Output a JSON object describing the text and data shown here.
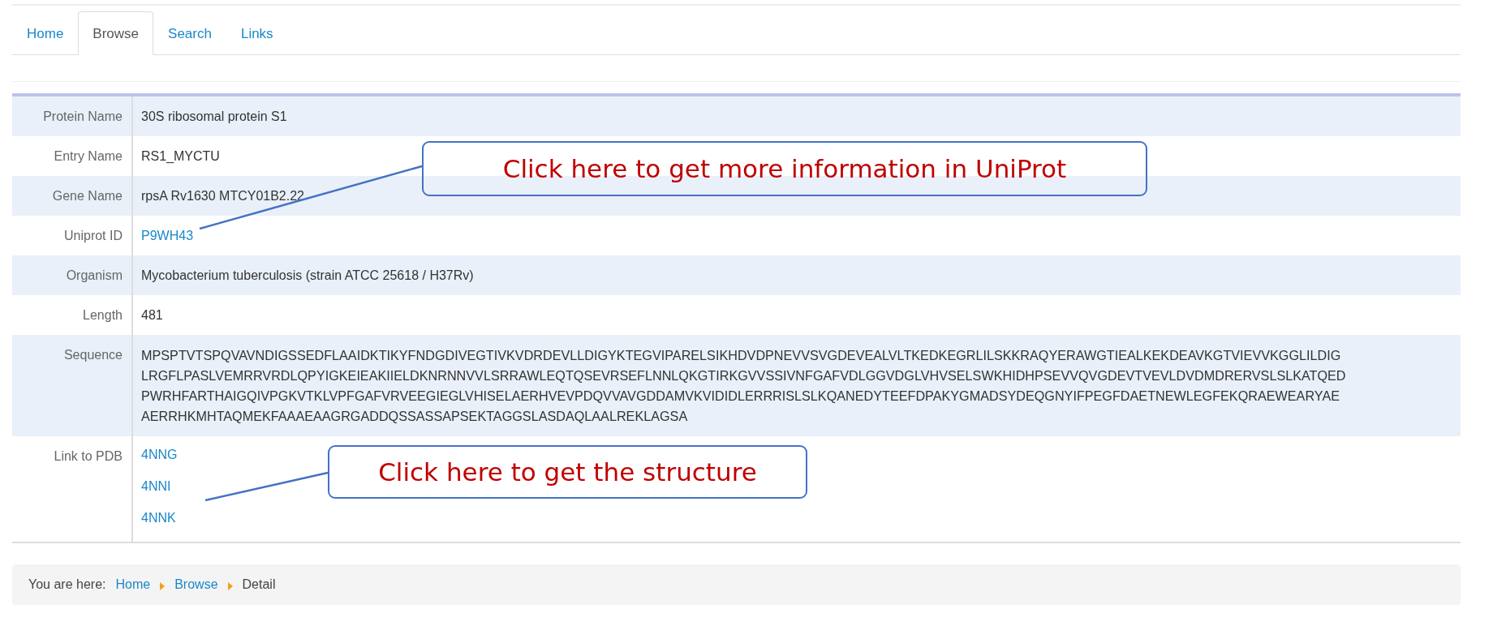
{
  "tabs": [
    {
      "label": "Home",
      "selected": false
    },
    {
      "label": "Browse",
      "selected": true
    },
    {
      "label": "Search",
      "selected": false
    },
    {
      "label": "Links",
      "selected": false
    }
  ],
  "details": [
    {
      "label": "Protein Name",
      "kind": "text",
      "value": "30S ribosomal protein S1"
    },
    {
      "label": "Entry Name",
      "kind": "text",
      "value": "RS1_MYCTU"
    },
    {
      "label": "Gene Name",
      "kind": "text",
      "value": "rpsA Rv1630 MTCY01B2.22"
    },
    {
      "label": "Uniprot ID",
      "kind": "links",
      "links": [
        "P9WH43"
      ]
    },
    {
      "label": "Organism",
      "kind": "text",
      "value": "Mycobacterium tuberculosis (strain ATCC 25618 / H37Rv)"
    },
    {
      "label": "Length",
      "kind": "text",
      "value": "481"
    },
    {
      "label": "Sequence",
      "kind": "sequence",
      "lines": [
        "MPSPTVTSPQVAVNDIGSSEDFLAAIDKTIKYFNDGDIVEGTIVKVDRDEVLLDIGYKTEGVIPARELSIKHDVDPNEVVSVGDEVEALVLTKEDKEGRLILSKKRAQYERAWGTIEALKEKDEAVKGTVIEVVKGGLILDIG",
        "LRGFLPASLVEMRRVRDLQPYIGKEIEAKIIELDKNRNNVVLSRRAWLEQTQSEVRSEFLNNLQKGTIRKGVVSSIVNFGAFVDLGGVDGLVHVSELSWKHIDHPSEVVQVGDEVTVEVLDVDMDRERVSLSLKATQED",
        "PWRHFARTHAIGQIVPGKVTKLVPFGAFVRVEEGIEGLVHISELAERHVEVPDQVVAVGDDAMVKVIDIDLERRRISLSLKQANEDYTEEFDPAKYGMADSYDEQGNYIFPEGFDAETNEWLEGFEKQRAEWEARYAE",
        "AERRHKMHTAQMEKFAAAEAAGRGADDQSSASSAPSEKTAGGSLASDAQLAALREKLAGSA"
      ]
    },
    {
      "label": "Link to PDB",
      "kind": "links",
      "links": [
        "4NNG",
        "4NNI",
        "4NNK"
      ]
    }
  ],
  "callouts": [
    {
      "text": "Click here to get more information in UniProt"
    },
    {
      "text": "Click here to get the structure"
    }
  ],
  "breadcrumb": {
    "prefix": "You are here:",
    "items": [
      {
        "label": "Home",
        "kind": "link"
      },
      {
        "label": "Browse",
        "kind": "link"
      },
      {
        "label": "Detail",
        "kind": "current"
      }
    ]
  }
}
